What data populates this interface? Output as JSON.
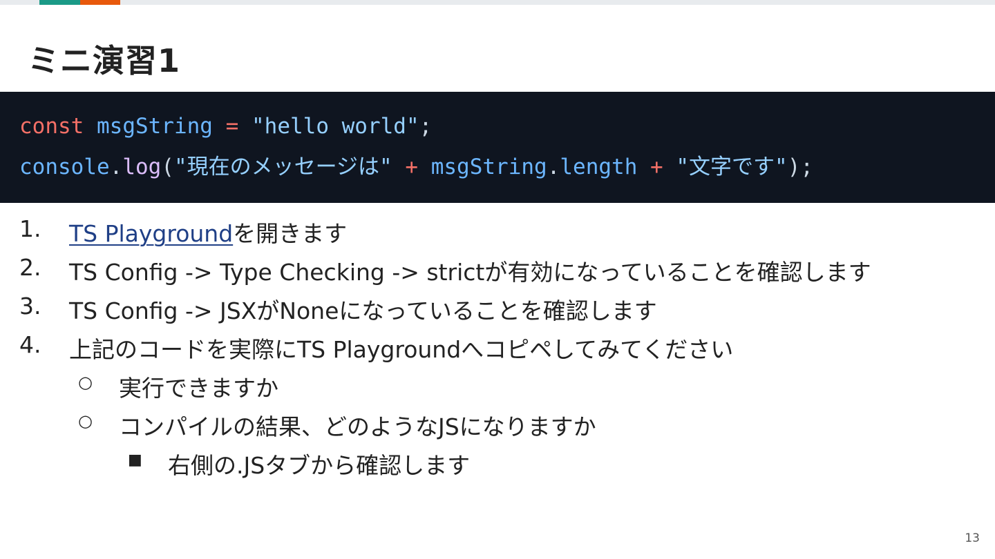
{
  "colors": {
    "accent_teal": "#1b9a87",
    "accent_orange": "#e8590c",
    "code_background": "#0f1520",
    "link": "#1f3f86"
  },
  "slide": {
    "title": "ミニ演習1",
    "page_number": "13"
  },
  "code": {
    "line1": {
      "keyword": "const",
      "var": "msgString",
      "op": "=",
      "string": "\"hello world\"",
      "end": ";"
    },
    "line2": {
      "object": "console",
      "dot1": ".",
      "method": "log",
      "open": "(",
      "string1": "\"現在のメッセージは\"",
      "plus1": "+",
      "var": "msgString",
      "dot2": ".",
      "prop": "length",
      "plus2": "+",
      "string2": "\"文字です\"",
      "close": ");"
    }
  },
  "steps": [
    {
      "number": "1.",
      "link_text": "TS Playground",
      "text": "を開きます"
    },
    {
      "number": "2.",
      "text": "TS Config -> Type Checking -> strictが有効になっていることを確認します"
    },
    {
      "number": "3.",
      "text": "TS Config -> JSXがNoneになっていることを確認します"
    },
    {
      "number": "4.",
      "text": "上記のコードを実際にTS Playgroundへコピペしてみてください",
      "subitems": [
        {
          "bullet": "○",
          "text": "実行できますか"
        },
        {
          "bullet": "○",
          "text": "コンパイルの結果、どのようなJSになりますか",
          "subitems": [
            {
              "bullet": "■",
              "text": "右側の.JSタブから確認します"
            }
          ]
        }
      ]
    }
  ]
}
